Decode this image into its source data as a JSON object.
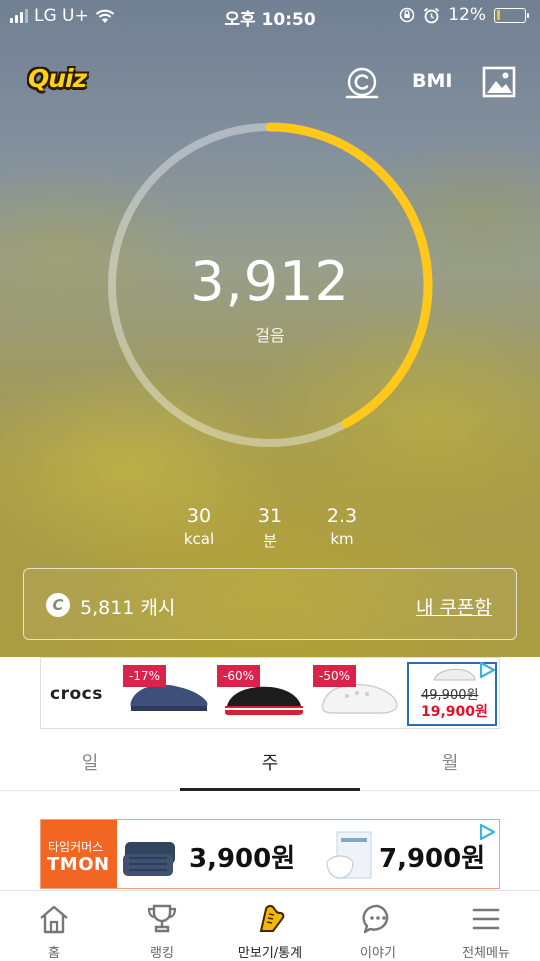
{
  "status_bar": {
    "carrier": "LG U+",
    "time": "오후 10:50",
    "battery_percent_text": "12%",
    "battery_level": 0.12,
    "icons": [
      "signal-icon",
      "wifi-icon",
      "rotation-lock-icon",
      "alarm-icon",
      "battery-icon"
    ]
  },
  "header": {
    "quiz_label": "Quiz",
    "cash_icon": "cash-c-icon",
    "bmi_label": "BMI",
    "image_icon": "image-icon"
  },
  "activity": {
    "steps": "3,912",
    "steps_unit": "걸음",
    "goal_progress": 0.42,
    "ring_color": "#ffc81a",
    "stats": [
      {
        "value": "30",
        "unit": "kcal"
      },
      {
        "value": "31",
        "unit": "분"
      },
      {
        "value": "2.3",
        "unit": "km"
      }
    ]
  },
  "cash": {
    "coin_symbol": "C",
    "amount_text": "5,811 캐시",
    "coupon_link": "내 쿠폰함"
  },
  "ad_crocs": {
    "brand": "crocs",
    "discounts": [
      "-17%",
      "-60%",
      "-50%"
    ],
    "old_price": "49,900원",
    "new_price": "19,900원"
  },
  "period_tabs": {
    "items": [
      "일",
      "주",
      "월"
    ],
    "active": "주"
  },
  "ad_tmon": {
    "brand_small": "타임커머스",
    "brand_big": "TMON",
    "price1": "3,900원",
    "price2": "7,900원"
  },
  "bottom_nav": {
    "items": [
      {
        "label": "홈",
        "icon": "home-icon"
      },
      {
        "label": "랭킹",
        "icon": "trophy-icon"
      },
      {
        "label": "만보기/통계",
        "icon": "shoe-icon"
      },
      {
        "label": "이야기",
        "icon": "chat-icon"
      },
      {
        "label": "전체메뉴",
        "icon": "menu-icon"
      }
    ],
    "active": "만보기/통계"
  },
  "colors": {
    "accent": "#ffc81a",
    "tmon_orange": "#f26522",
    "sale_badge": "#d9234a",
    "sale_price": "#e0112b"
  }
}
